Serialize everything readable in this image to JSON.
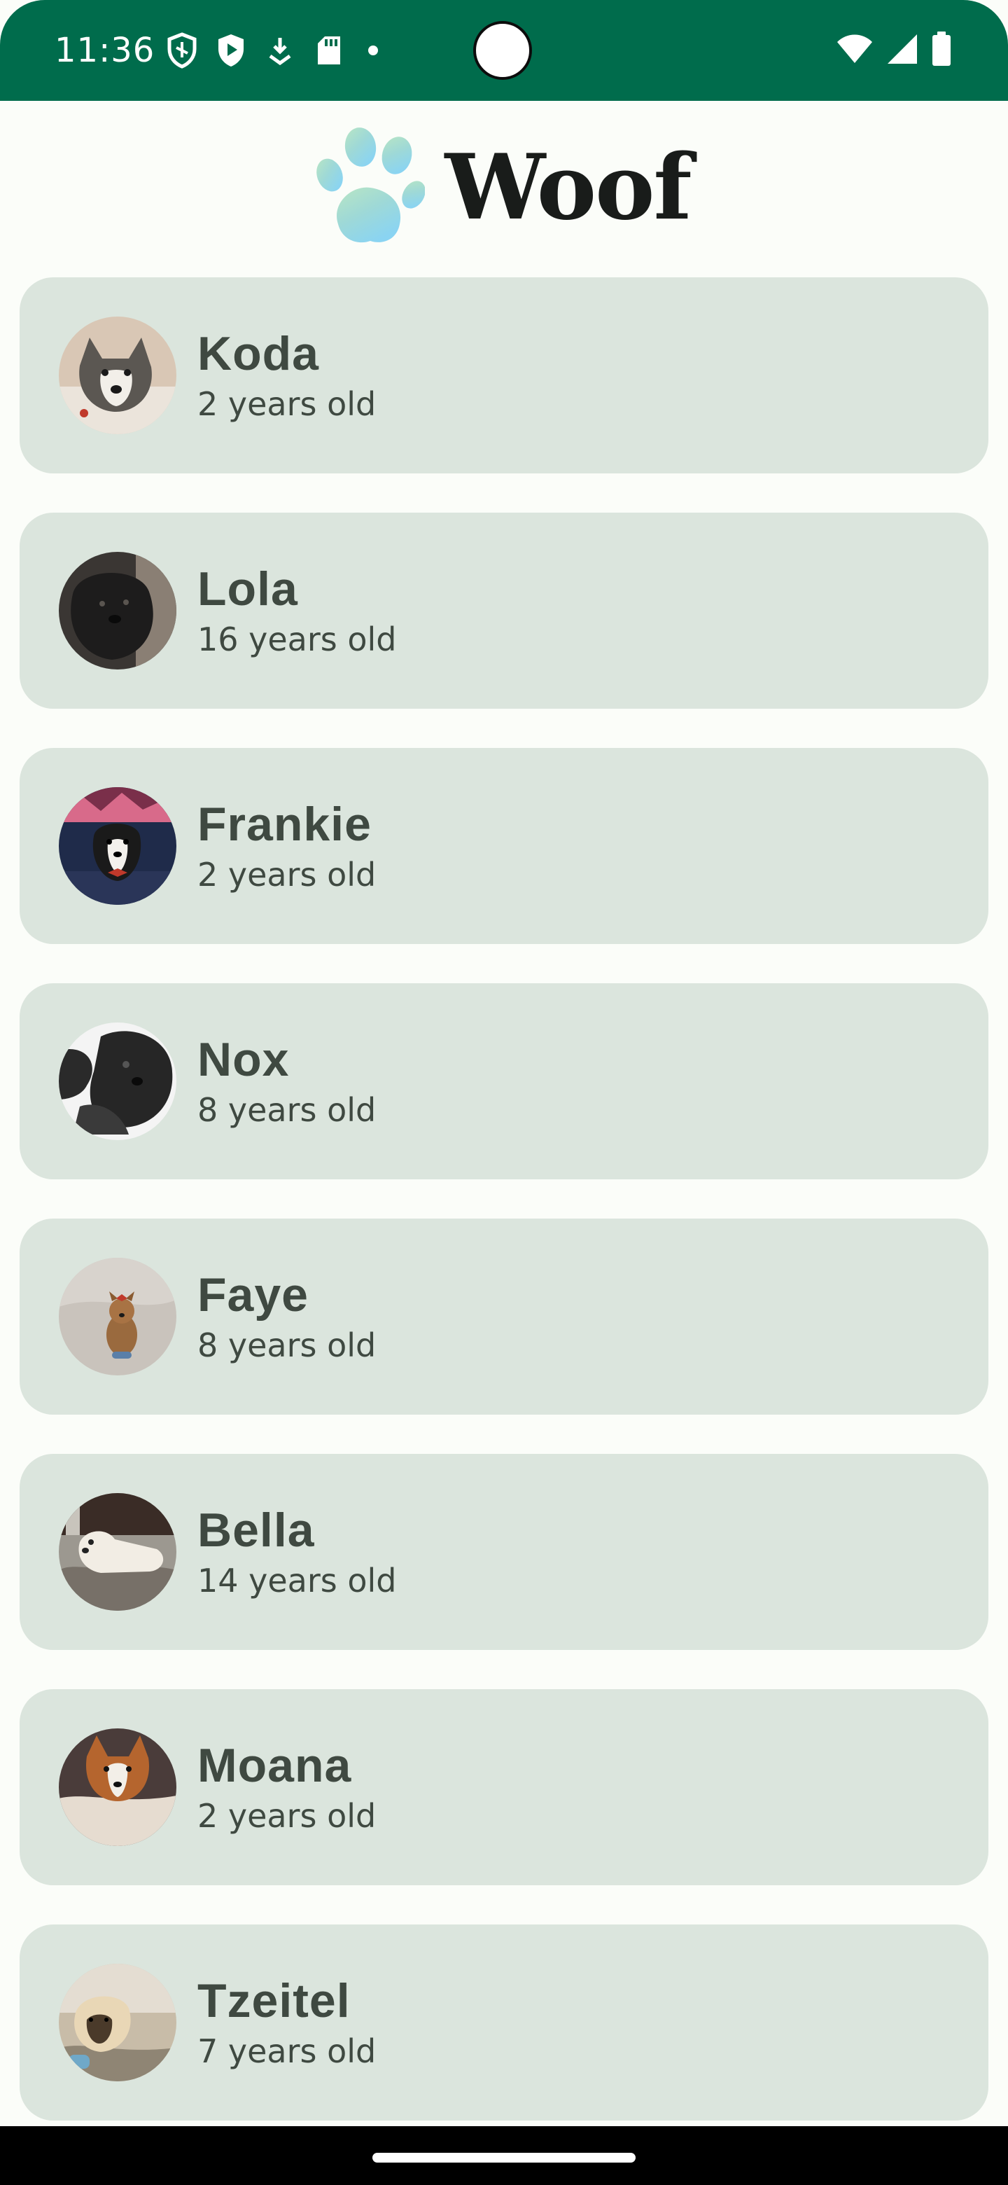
{
  "status_bar": {
    "time": "11:36",
    "left_icons": [
      "vpn-shield-icon",
      "play-protect-icon",
      "download-icon",
      "sd-card-icon",
      "notification-dot-icon"
    ],
    "right_icons": [
      "wifi-icon",
      "cell-signal-icon",
      "battery-icon"
    ],
    "background": "#006c4c"
  },
  "app_bar": {
    "title": "Woof",
    "logo_icon": "paw-icon"
  },
  "dogs": [
    {
      "name": "Koda",
      "age": "2 years old"
    },
    {
      "name": "Lola",
      "age": "16 years old"
    },
    {
      "name": "Frankie",
      "age": "2 years old"
    },
    {
      "name": "Nox",
      "age": "8 years old"
    },
    {
      "name": "Faye",
      "age": "8 years old"
    },
    {
      "name": "Bella",
      "age": "14 years old"
    },
    {
      "name": "Moana",
      "age": "2 years old"
    },
    {
      "name": "Tzeitel",
      "age": "7 years old"
    }
  ],
  "colors": {
    "card_background": "#dbe5dd",
    "page_background": "#fbfdf9",
    "text": "#3f4941"
  }
}
